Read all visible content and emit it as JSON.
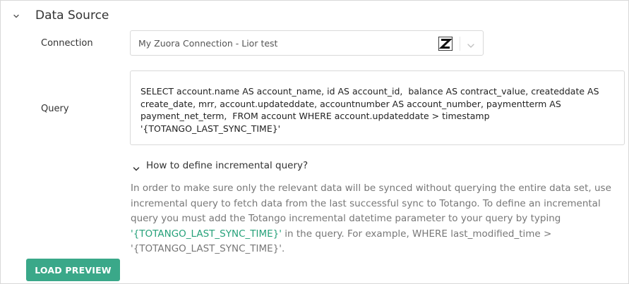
{
  "section": {
    "title": "Data Source",
    "chevron_icon": "chevron-down-icon"
  },
  "connection": {
    "label": "Connection",
    "selected_value": "My Zuora Connection - Lior test",
    "logo_icon": "zuora-logo-icon",
    "chevron_icon": "chevron-down-icon"
  },
  "query": {
    "label": "Query",
    "value": "SELECT account.name AS account_name, id AS account_id,  balance AS contract_value, createddate AS create_date, mrr, account.updateddate, accountnumber AS account_number, paymentterm AS payment_net_term,  FROM account WHERE account.updateddate > timestamp '{TOTANGO_LAST_SYNC_TIME}'"
  },
  "help": {
    "toggle_label": "How to define incremental query?",
    "text_before": "In order to make sure only the relevant data will be synced without querying the entire data set, use incremental query to fetch data from the last successful sync to Totango. To define an incremental query you must add the Totango incremental datetime parameter to your query by typing ",
    "highlight": "'{TOTANGO_LAST_SYNC_TIME}'",
    "text_after": " in the query. For example, WHERE last_modified_time > '{TOTANGO_LAST_SYNC_TIME}'."
  },
  "actions": {
    "load_preview_label": "LOAD PREVIEW"
  },
  "colors": {
    "accent": "#3aa889",
    "highlight_text": "#26a17a",
    "border": "#d9d9d9"
  }
}
